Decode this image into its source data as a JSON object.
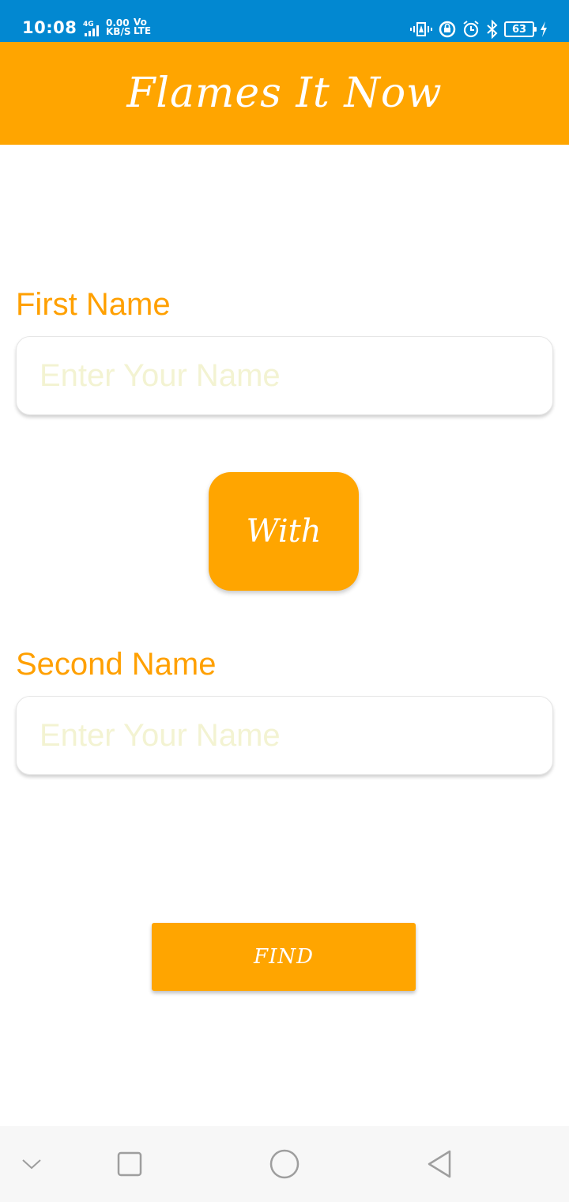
{
  "status_bar": {
    "time": "10:08",
    "network_type": "4G",
    "speed_value": "0.00",
    "speed_unit": "KB/S",
    "volte_top": "Vo",
    "volte_bottom": "LTE",
    "battery_level": "63",
    "icons": [
      "vibrate-icon",
      "data-saver-icon",
      "alarm-icon",
      "bluetooth-icon",
      "battery-icon",
      "charging-icon"
    ]
  },
  "app_bar": {
    "title": "Flames It Now"
  },
  "form": {
    "first_label": "First Name",
    "first_placeholder": "Enter Your Name",
    "first_value": "",
    "with_label": "With",
    "second_label": "Second Name",
    "second_placeholder": "Enter Your Name",
    "second_value": "",
    "find_label": "FIND"
  },
  "nav_bar": {
    "icons": [
      "chevron-down-icon",
      "recents-icon",
      "home-icon",
      "back-icon"
    ]
  },
  "colors": {
    "status_bar": "#0288d1",
    "accent": "#ffa500",
    "label_text": "#ffa000",
    "placeholder": "#f3f3d2",
    "nav_bar": "#f7f7f7"
  }
}
